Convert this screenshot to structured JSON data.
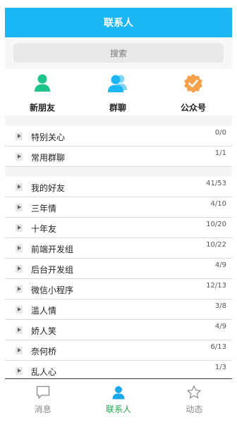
{
  "header": {
    "title": "联系人"
  },
  "search": {
    "placeholder": "搜索"
  },
  "shortcuts": [
    {
      "label": "新朋友",
      "icon": "person-icon",
      "color": "#1fc48a"
    },
    {
      "label": "群聊",
      "icon": "group-icon",
      "color": "#1ab7f4"
    },
    {
      "label": "公众号",
      "icon": "badge-check-icon",
      "color": "#f5a04a"
    }
  ],
  "special_groups": [
    {
      "name": "特别关心",
      "count": "0/0"
    },
    {
      "name": "常用群聊",
      "count": "1/1"
    }
  ],
  "groups": [
    {
      "name": "我的好友",
      "count": "41/53"
    },
    {
      "name": "三年情",
      "count": "4/10"
    },
    {
      "name": "十年友",
      "count": "10/20"
    },
    {
      "name": "前端开发组",
      "count": "10/22"
    },
    {
      "name": "后台开发组",
      "count": "4/9"
    },
    {
      "name": "微信小程序",
      "count": "12/13"
    },
    {
      "name": "滥人情",
      "count": "3/8"
    },
    {
      "name": "娇人笑",
      "count": "4/9"
    },
    {
      "name": "奈何桥",
      "count": "6/13"
    },
    {
      "name": "乱人心",
      "count": "1/3"
    }
  ],
  "tabbar": {
    "messages": "消息",
    "contacts": "联系人",
    "moments": "动态",
    "active_color": "#1aa84a"
  }
}
